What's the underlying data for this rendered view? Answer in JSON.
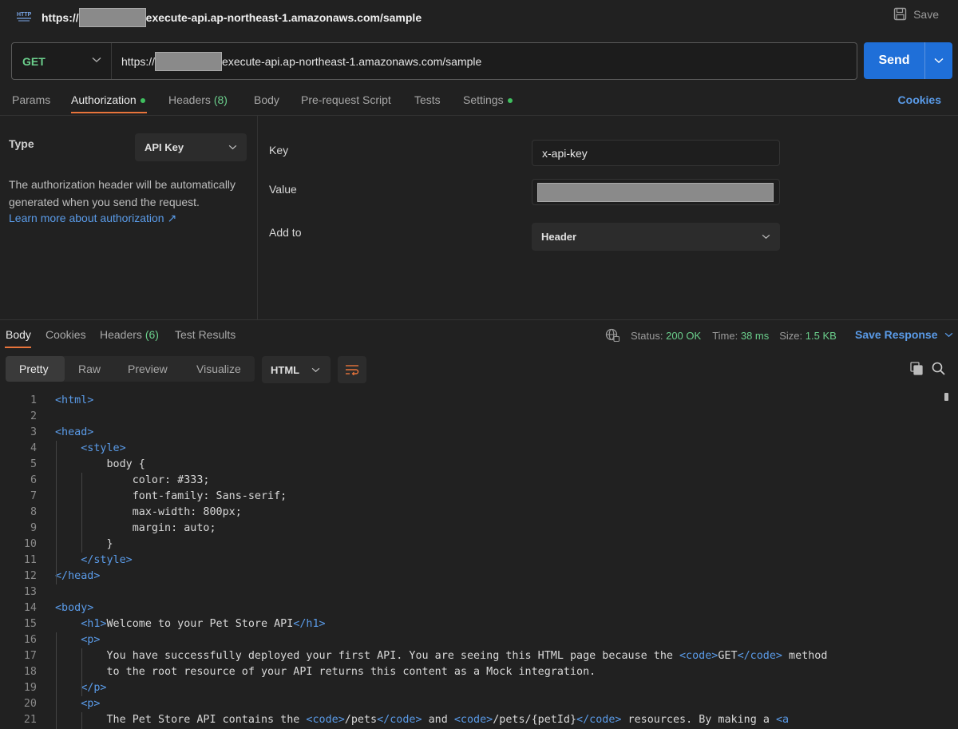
{
  "title_bar": {
    "http_badge": "HTTP",
    "url_prefix": "https://",
    "url_suffix": "execute-api.ap-northeast-1.amazonaws.com/sample",
    "save_label": "Save"
  },
  "request": {
    "method": "GET",
    "url_prefix": "https://",
    "url_suffix": "execute-api.ap-northeast-1.amazonaws.com/sample",
    "send_label": "Send"
  },
  "request_tabs": {
    "params": "Params",
    "authorization": "Authorization",
    "headers": "Headers",
    "headers_count": "(8)",
    "body": "Body",
    "prerequest": "Pre-request Script",
    "tests": "Tests",
    "settings": "Settings",
    "cookies": "Cookies"
  },
  "auth": {
    "type_label": "Type",
    "type_value": "API Key",
    "help_text": "The authorization header will be automatically generated when you send the request.",
    "help_link": "Learn more about authorization ↗",
    "key_label": "Key",
    "key_value": "x-api-key",
    "value_label": "Value",
    "add_to_label": "Add to",
    "add_to_value": "Header"
  },
  "response": {
    "tabs": {
      "body": "Body",
      "cookies": "Cookies",
      "headers": "Headers",
      "headers_count": "(6)",
      "test_results": "Test Results"
    },
    "status_label": "Status:",
    "status_value": "200 OK",
    "time_label": "Time:",
    "time_value": "38 ms",
    "size_label": "Size:",
    "size_value": "1.5 KB",
    "save_response": "Save Response",
    "views": {
      "pretty": "Pretty",
      "raw": "Raw",
      "preview": "Preview",
      "visualize": "Visualize"
    },
    "language": "HTML"
  },
  "code_lines": [
    {
      "n": "1",
      "text": "<html>"
    },
    {
      "n": "2",
      "text": ""
    },
    {
      "n": "3",
      "text": "<head>"
    },
    {
      "n": "4",
      "text": "    <style>"
    },
    {
      "n": "5",
      "text": "        body {"
    },
    {
      "n": "6",
      "text": "            color: #333;"
    },
    {
      "n": "7",
      "text": "            font-family: Sans-serif;"
    },
    {
      "n": "8",
      "text": "            max-width: 800px;"
    },
    {
      "n": "9",
      "text": "            margin: auto;"
    },
    {
      "n": "10",
      "text": "        }"
    },
    {
      "n": "11",
      "text": "    </style>"
    },
    {
      "n": "12",
      "text": "</head>"
    },
    {
      "n": "13",
      "text": ""
    },
    {
      "n": "14",
      "text": "<body>"
    },
    {
      "n": "15",
      "text": "    <h1>Welcome to your Pet Store API</h1>"
    },
    {
      "n": "16",
      "text": "    <p>"
    },
    {
      "n": "17",
      "text": "        You have successfully deployed your first API. You are seeing this HTML page because the <code>GET</code> method"
    },
    {
      "n": "18",
      "text": "        to the root resource of your API returns this content as a Mock integration."
    },
    {
      "n": "19",
      "text": "    </p>"
    },
    {
      "n": "20",
      "text": "    <p>"
    },
    {
      "n": "21",
      "text": "        The Pet Store API contains the <code>/pets</code> and <code>/pets/{petId}</code> resources. By making a <a"
    }
  ]
}
